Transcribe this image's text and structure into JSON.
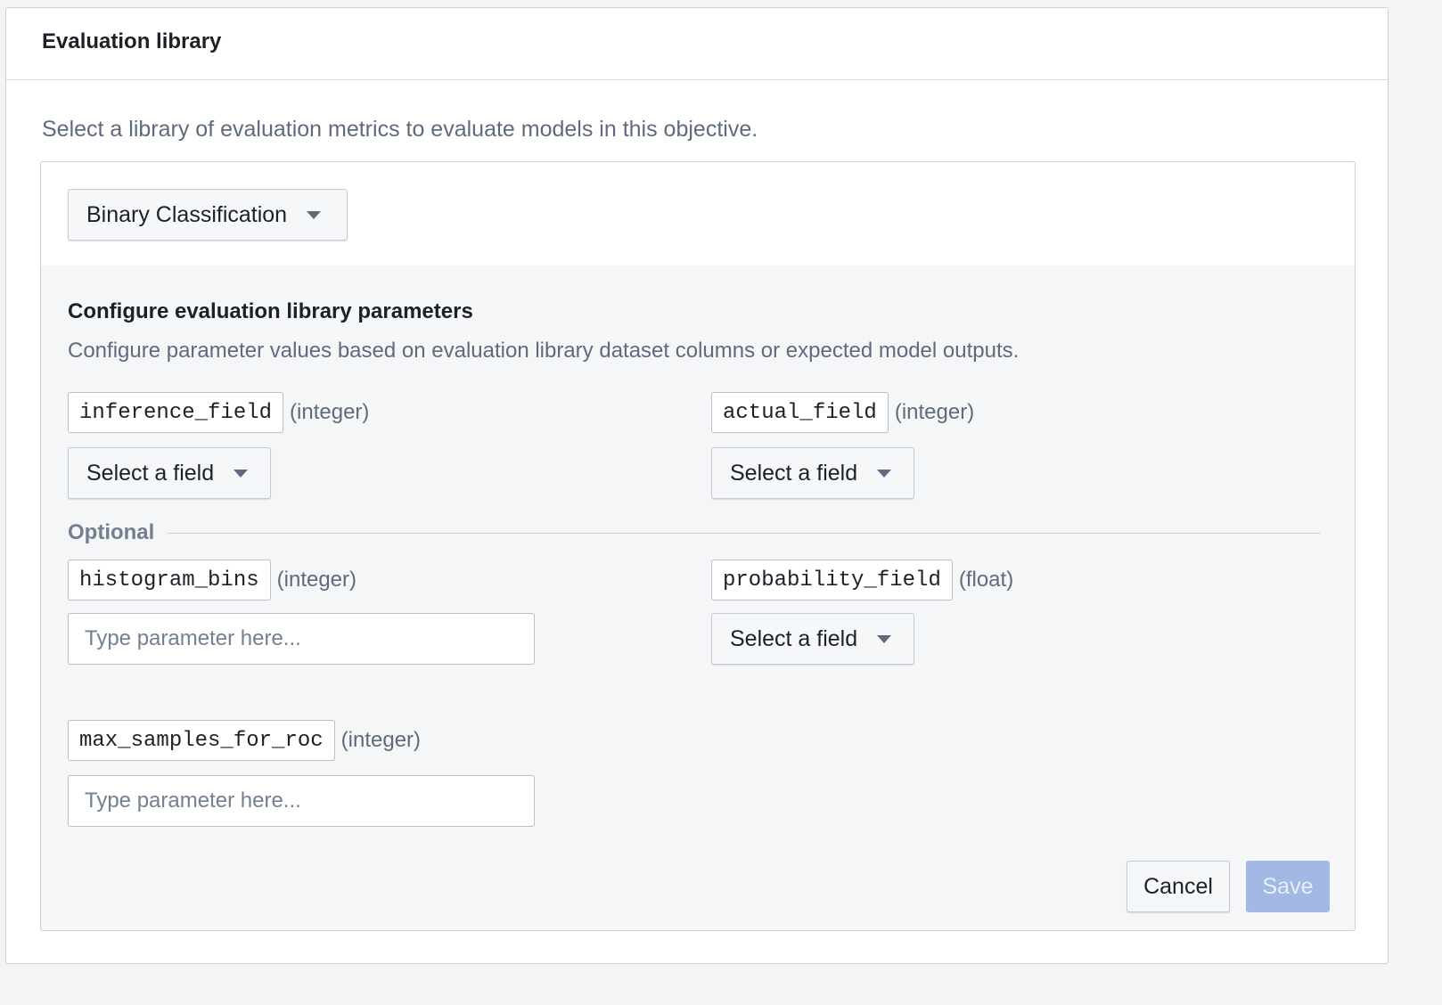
{
  "header": {
    "title": "Evaluation library"
  },
  "description": "Select a library of evaluation metrics to evaluate models in this objective.",
  "library_select": {
    "value": "Binary Classification"
  },
  "config": {
    "title": "Configure evaluation library parameters",
    "description": "Configure parameter values based on evaluation library dataset columns or expected model outputs."
  },
  "params": {
    "inference_field": {
      "name": "inference_field",
      "type": "(integer)",
      "value": "Select a field"
    },
    "actual_field": {
      "name": "actual_field",
      "type": "(integer)",
      "value": "Select a field"
    },
    "histogram_bins": {
      "name": "histogram_bins",
      "type": "(integer)",
      "placeholder": "Type parameter here..."
    },
    "probability_field": {
      "name": "probability_field",
      "type": "(float)",
      "value": "Select a field"
    },
    "max_samples_for_roc": {
      "name": "max_samples_for_roc",
      "type": "(integer)",
      "placeholder": "Type parameter here..."
    }
  },
  "optional_label": "Optional",
  "actions": {
    "cancel": "Cancel",
    "save": "Save"
  },
  "colors": {
    "save_disabled_bg": "#a3b8e3",
    "page_bg": "#f3f4f6",
    "muted_text": "#5f6b7c"
  },
  "icons": {
    "caret": "caret-down-icon"
  }
}
